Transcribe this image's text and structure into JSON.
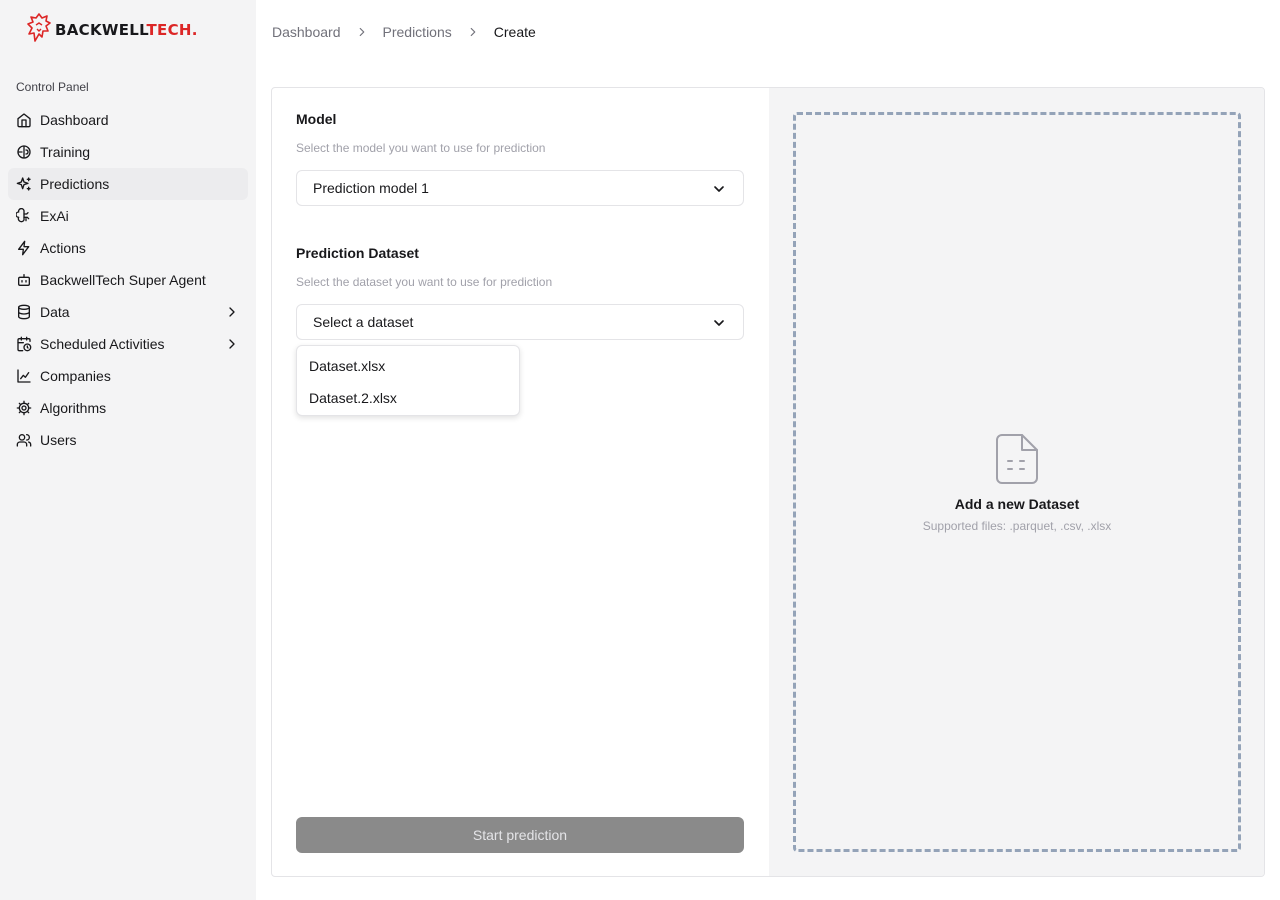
{
  "brand": {
    "name_part1": "BACKWELL",
    "name_part2": "TECH.",
    "accent_color": "#dc2626"
  },
  "sidebar": {
    "section_label": "Control Panel",
    "items": [
      {
        "label": "Dashboard",
        "icon": "home-icon"
      },
      {
        "label": "Training",
        "icon": "brain-icon"
      },
      {
        "label": "Predictions",
        "icon": "sparkles-icon",
        "active": true
      },
      {
        "label": "ExAi",
        "icon": "brain-circuit-icon"
      },
      {
        "label": "Actions",
        "icon": "zap-icon"
      },
      {
        "label": "BackwellTech Super Agent",
        "icon": "bot-icon"
      },
      {
        "label": "Data",
        "icon": "database-icon",
        "has_submenu": true
      },
      {
        "label": "Scheduled Activities",
        "icon": "calendar-clock-icon",
        "has_submenu": true
      },
      {
        "label": "Companies",
        "icon": "chart-icon"
      },
      {
        "label": "Algorithms",
        "icon": "cog-icon"
      },
      {
        "label": "Users",
        "icon": "users-icon"
      }
    ]
  },
  "breadcrumb": [
    "Dashboard",
    "Predictions",
    "Create"
  ],
  "form": {
    "model": {
      "label": "Model",
      "hint": "Select the model you want to use for prediction",
      "value": "Prediction model 1"
    },
    "dataset": {
      "label": "Prediction Dataset",
      "hint": "Select the dataset you want to use for prediction",
      "placeholder": "Select a dataset",
      "options": [
        "Dataset.xlsx",
        "Dataset.2.xlsx"
      ]
    },
    "start_button": "Start prediction"
  },
  "upload": {
    "title": "Add a new Dataset",
    "subtitle": "Supported files: .parquet, .csv, .xlsx"
  }
}
